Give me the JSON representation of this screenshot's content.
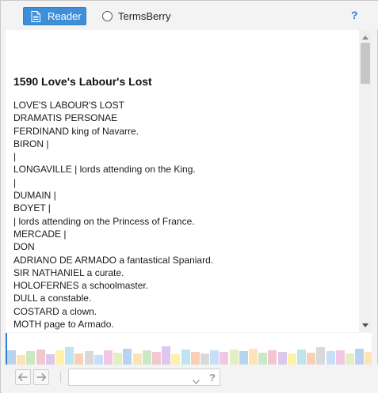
{
  "toolbar": {
    "reader_label": "Reader",
    "termsberry_label": "TermsBerry",
    "help_label": "?",
    "accent_color": "#3f8fd8"
  },
  "document": {
    "title": "1590 Love's Labour's Lost",
    "lines": [
      "LOVE'S LABOUR'S LOST",
      "DRAMATIS PERSONAE",
      "FERDINAND king of Navarre.",
      "BIRON |",
      "|",
      "LONGAVILLE | lords attending on the King.",
      "|",
      "DUMAIN |",
      "BOYET |",
      "| lords attending on the Princess of France.",
      "MERCADE |",
      "DON",
      "ADRIANO DE ARMADO a fantastical Spaniard.",
      "SIR NATHANIEL a curate.",
      "HOLOFERNES a schoolmaster.",
      "DULL a constable.",
      "COSTARD a clown.",
      "MOTH page to Armado."
    ]
  },
  "scrollbar": {
    "up_icon": "triangle-up-icon",
    "down_icon": "triangle-down-icon"
  },
  "minimap": {
    "colors": [
      "#b9d3ef",
      "#fde3b5",
      "#c9e9c5",
      "#f4c6cf",
      "#dcc8ea",
      "#fff1a8",
      "#bfe3f1",
      "#f7d0b5",
      "#d9d9d9",
      "#c6dff6",
      "#f1c7e3",
      "#e2efc3"
    ],
    "heights": [
      0.45,
      0.3,
      0.42,
      0.48,
      0.32,
      0.44,
      0.55,
      0.35,
      0.42,
      0.3,
      0.46,
      0.38,
      0.5,
      0.36,
      0.44,
      0.4,
      0.58,
      0.33,
      0.47,
      0.4,
      0.36,
      0.44,
      0.39,
      0.47,
      0.42,
      0.5,
      0.37,
      0.45,
      0.4,
      0.34,
      0.48,
      0.38,
      0.55,
      0.42,
      0.46,
      0.35,
      0.5,
      0.41
    ]
  },
  "bottombar": {
    "back_icon": "arrow-left-icon",
    "forward_icon": "arrow-right-icon",
    "select_value": "",
    "help_label": "?"
  }
}
